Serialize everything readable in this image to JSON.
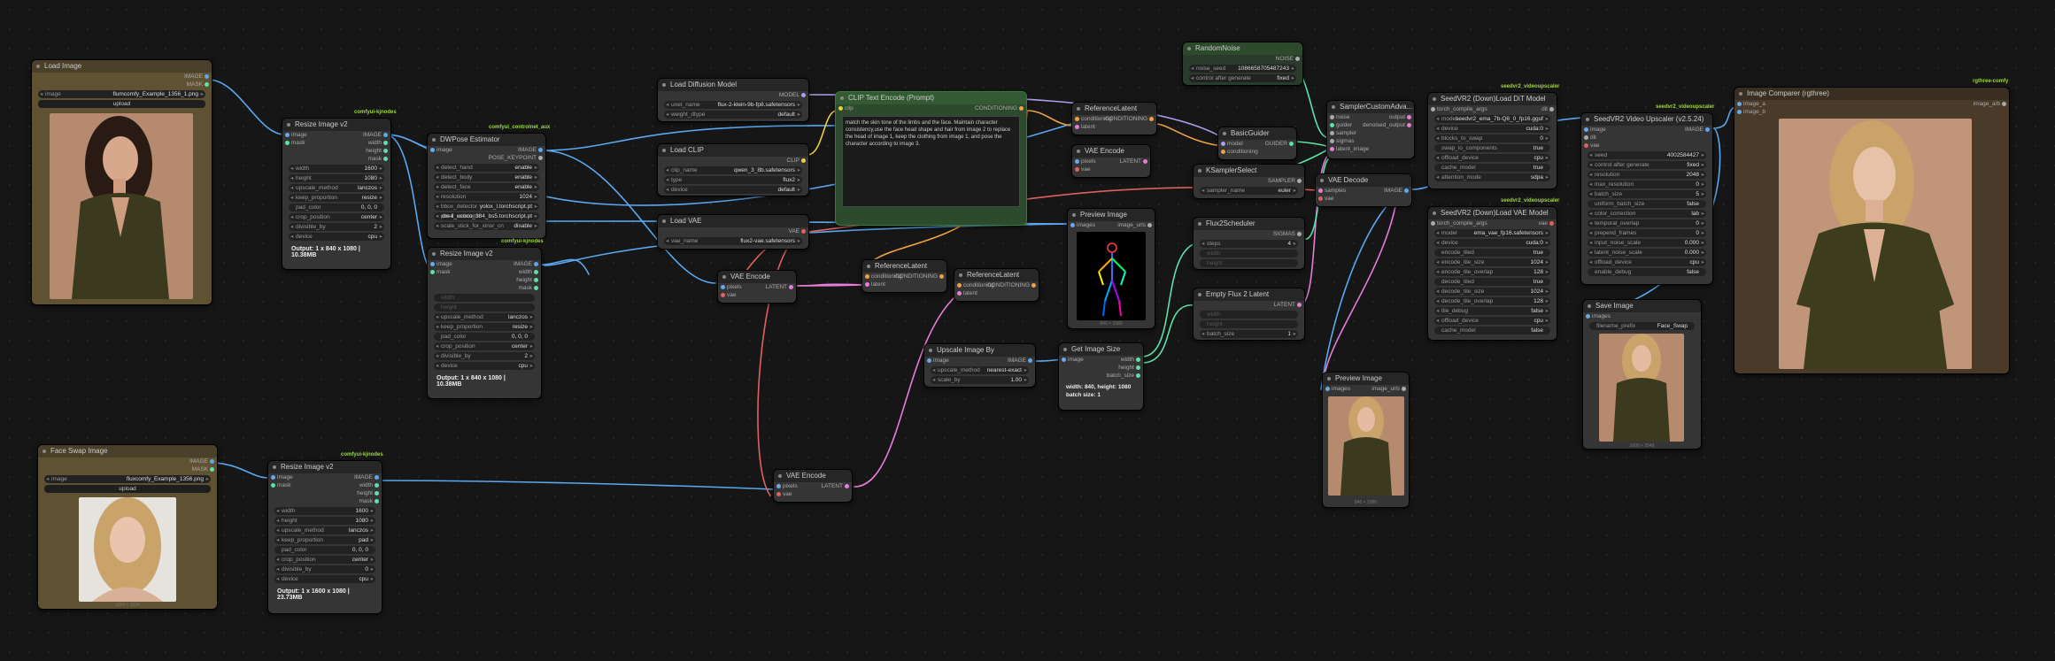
{
  "tags": {
    "comfyui_kjnodes": "comfyui-kjnodes",
    "controlnet_aux": "comfyui_controlnet_aux",
    "videoupscaler": "seedvr2_videoupscaler",
    "rgthree": "rgthree-comfy"
  },
  "load_image": {
    "title": "Load Image",
    "out_image": "IMAGE",
    "out_mask": "MASK",
    "image_label": "image",
    "image_value": "flumcomfy_Example_1356_1.png",
    "upload": "upload"
  },
  "face_swap": {
    "title": "Face Swap Image",
    "out_image": "IMAGE",
    "out_mask": "MASK",
    "image_label": "image",
    "image_value": "fluxcomfy_Example_1356.png",
    "upload": "upload",
    "caption": "1024 × 1024"
  },
  "resize1": {
    "title": "Resize Image v2",
    "in_image": "image",
    "in_mask": "mask",
    "out_image": "IMAGE",
    "out_width": "width",
    "out_height": "height",
    "out_mask": "mask",
    "widgets": [
      {
        "k": "width",
        "v": "1600"
      },
      {
        "k": "height",
        "v": "1080"
      },
      {
        "k": "upscale_method",
        "v": "lanczos"
      },
      {
        "k": "keep_proportion",
        "v": "resize"
      },
      {
        "k": "pad_color",
        "v": "0, 0, 0"
      },
      {
        "k": "crop_position",
        "v": "center"
      },
      {
        "k": "divisible_by",
        "v": "2"
      },
      {
        "k": "device",
        "v": "cpu"
      }
    ],
    "output": "Output: 1 x 840 x 1080 | 10.38MB"
  },
  "resize2": {
    "title": "Resize Image v2",
    "in_image": "image",
    "in_mask": "mask",
    "out_image": "IMAGE",
    "out_width": "width",
    "out_height": "height",
    "out_mask": "mask",
    "widgets": [
      {
        "k": "width",
        "v": ""
      },
      {
        "k": "height",
        "v": ""
      },
      {
        "k": "upscale_method",
        "v": "lanczos"
      },
      {
        "k": "keep_proportion",
        "v": "resize"
      },
      {
        "k": "pad_color",
        "v": "0, 0, 0"
      },
      {
        "k": "crop_position",
        "v": "center"
      },
      {
        "k": "divisible_by",
        "v": "2"
      },
      {
        "k": "device",
        "v": "cpu"
      }
    ],
    "output": "Output: 1 x 840 x 1080 | 10.38MB"
  },
  "resize3": {
    "title": "Resize Image v2",
    "in_image": "image",
    "in_mask": "mask",
    "out_image": "IMAGE",
    "out_width": "width",
    "out_height": "height",
    "out_mask": "mask",
    "widgets": [
      {
        "k": "width",
        "v": "1600"
      },
      {
        "k": "height",
        "v": "1080"
      },
      {
        "k": "upscale_method",
        "v": "lanczos"
      },
      {
        "k": "keep_proportion",
        "v": "pad"
      },
      {
        "k": "pad_color",
        "v": "0, 0, 0"
      },
      {
        "k": "crop_position",
        "v": "center"
      },
      {
        "k": "divisible_by",
        "v": "0"
      },
      {
        "k": "device",
        "v": "cpu"
      }
    ],
    "output": "Output: 1 x 1600 x 1080 | 23.73MB"
  },
  "dwpose": {
    "title": "DWPose Estimator",
    "in_image": "image",
    "out_image": "IMAGE",
    "out_kp": "POSE_KEYPOINT",
    "widgets": [
      {
        "k": "detect_hand",
        "v": "enable"
      },
      {
        "k": "detect_body",
        "v": "enable"
      },
      {
        "k": "detect_face",
        "v": "enable"
      },
      {
        "k": "resolution",
        "v": "1024"
      },
      {
        "k": "bbox_detector",
        "v": "yolox_l.torchscript.pt"
      },
      {
        "k": "pose_estimator",
        "v": "dw-ll_ucoco_384_bs5.torchscript.pt"
      },
      {
        "k": "scale_stick_for_xinsr_cn",
        "v": "disable"
      }
    ]
  },
  "load_diffusion": {
    "title": "Load Diffusion Model",
    "out": "MODEL",
    "widgets": [
      {
        "k": "unet_name",
        "v": "flux-2-klein-9b-fp8.safetensors"
      },
      {
        "k": "weight_dtype",
        "v": "default"
      }
    ]
  },
  "load_clip": {
    "title": "Load CLIP",
    "out": "CLIP",
    "widgets": [
      {
        "k": "clip_name",
        "v": "qwen_3_8b.safetensors"
      },
      {
        "k": "type",
        "v": "flux2"
      },
      {
        "k": "device",
        "v": "default"
      }
    ]
  },
  "load_vae": {
    "title": "Load VAE",
    "out": "VAE",
    "widgets": [
      {
        "k": "vae_name",
        "v": "flux2-vae.safetensors"
      }
    ]
  },
  "clip_text": {
    "title": "CLIP Text Encode (Prompt)",
    "in_clip": "clip",
    "out": "CONDITIONING",
    "text": "match the skin tone of the limbs and the face. Maintain character consistency,use the face head shape and hair from image 2 to replace the head of image 1, keep the clothing from image 1, and pose the character according to image 3."
  },
  "vae_encode1": {
    "title": "VAE Encode",
    "in_pixels": "pixels",
    "in_vae": "vae",
    "out": "LATENT"
  },
  "vae_encode2": {
    "title": "VAE Encode",
    "in_pixels": "pixels",
    "in_vae": "vae",
    "out": "LATENT"
  },
  "vae_encode3": {
    "title": "VAE Encode",
    "in_pixels": "pixels",
    "in_vae": "vae",
    "out": "LATENT"
  },
  "ref_latent1": {
    "title": "ReferenceLatent",
    "in_cond": "conditioning",
    "in_latent": "latent",
    "out": "CONDITIONING"
  },
  "ref_latent2": {
    "title": "ReferenceLatent",
    "in_cond": "conditioning",
    "in_latent": "latent",
    "out": "CONDITIONING"
  },
  "ref_latent3": {
    "title": "ReferenceLatent",
    "in_cond": "conditioning",
    "in_latent": "latent",
    "out": "CONDITIONING"
  },
  "preview1": {
    "title": "Preview Image",
    "in_images": "images",
    "out": "image_urls",
    "caption": "840 × 1080"
  },
  "preview2": {
    "title": "Preview Image",
    "in_images": "images",
    "out": "image_urls",
    "caption": "840 × 1080"
  },
  "upscale_by": {
    "title": "Upscale Image By",
    "in_image": "image",
    "out": "IMAGE",
    "widgets": [
      {
        "k": "upscale_method",
        "v": "nearest-exact"
      },
      {
        "k": "scale_by",
        "v": "1.00"
      }
    ]
  },
  "image_size": {
    "title": "Get Image Size",
    "in_image": "image",
    "out_w": "width",
    "out_h": "height",
    "out_b": "batch_size",
    "info1": "width: 840, height: 1080",
    "info2": "batch size: 1"
  },
  "random_noise": {
    "title": "RandomNoise",
    "out": "NOISE",
    "widgets": [
      {
        "k": "noise_seed",
        "v": "1086658705487243"
      },
      {
        "k": "control after generate",
        "v": "fixed"
      }
    ]
  },
  "basic_guider": {
    "title": "BasicGuider",
    "in_model": "model",
    "in_cond": "conditioning",
    "out": "GUIDER"
  },
  "ksampler_select": {
    "title": "KSamplerSelect",
    "out": "SAMPLER",
    "widgets": [
      {
        "k": "sampler_name",
        "v": "euler"
      }
    ]
  },
  "flux2_scheduler": {
    "title": "Flux2Scheduler",
    "out": "SIGMAS",
    "widgets": [
      {
        "k": "steps",
        "v": "4"
      },
      {
        "k": "width",
        "v": ""
      },
      {
        "k": "height",
        "v": ""
      }
    ]
  },
  "empty_latent": {
    "title": "Empty Flux 2 Latent",
    "out": "LATENT",
    "widgets": [
      {
        "k": "width",
        "v": ""
      },
      {
        "k": "height",
        "v": ""
      },
      {
        "k": "batch_size",
        "v": "1"
      }
    ]
  },
  "sampler_custom": {
    "title": "SamplerCustomAdva...",
    "inputs": [
      "noise",
      "guider",
      "sampler",
      "sigmas",
      "latent_image"
    ],
    "out1": "output",
    "out2": "denoised_output"
  },
  "vae_decode": {
    "title": "VAE Decode",
    "in_samples": "samples",
    "in_vae": "vae",
    "out": "IMAGE"
  },
  "seedvr_dit": {
    "title": "SeedVR2 (Down)Load DiT Model",
    "out": "dit",
    "in_args": "torch_compile_args",
    "widgets": [
      {
        "k": "model",
        "v": "seedvr2_ema_7b-Q8_0_fp16.gguf"
      },
      {
        "k": "device",
        "v": "cuda:0"
      },
      {
        "k": "blocks_to_swap",
        "v": "0"
      },
      {
        "k": "swap_io_components",
        "v": "true"
      },
      {
        "k": "offload_device",
        "v": "cpu"
      },
      {
        "k": "cache_model",
        "v": "true"
      },
      {
        "k": "attention_mode",
        "v": "sdpa"
      }
    ]
  },
  "seedvr_vae": {
    "title": "SeedVR2 (Down)Load VAE Model",
    "out": "vae",
    "in_args": "torch_compile_args",
    "widgets": [
      {
        "k": "model",
        "v": "ema_vae_fp16.safetensors"
      },
      {
        "k": "device",
        "v": "cuda:0"
      },
      {
        "k": "encode_tiled",
        "v": "true"
      },
      {
        "k": "encode_tile_size",
        "v": "1024"
      },
      {
        "k": "encode_tile_overlap",
        "v": "128"
      },
      {
        "k": "decode_tiled",
        "v": "true"
      },
      {
        "k": "decode_tile_size",
        "v": "1024"
      },
      {
        "k": "decode_tile_overlap",
        "v": "128"
      },
      {
        "k": "tile_debug",
        "v": "false"
      },
      {
        "k": "offload_device",
        "v": "cpu"
      },
      {
        "k": "cache_model",
        "v": "false"
      }
    ]
  },
  "seedvr_upscaler": {
    "title": "SeedVR2 Video Upscaler (v2.5.24)",
    "in_image": "image",
    "in_dit": "dit",
    "in_vae": "vae",
    "out": "IMAGE",
    "widgets": [
      {
        "k": "seed",
        "v": "4002584427"
      },
      {
        "k": "control after generate",
        "v": "fixed"
      },
      {
        "k": "resolution",
        "v": "2048"
      },
      {
        "k": "max_resolution",
        "v": "0"
      },
      {
        "k": "batch_size",
        "v": "5"
      },
      {
        "k": "uniform_batch_size",
        "v": "false"
      },
      {
        "k": "color_correction",
        "v": "lab"
      },
      {
        "k": "temporal_overlap",
        "v": "0"
      },
      {
        "k": "prepend_frames",
        "v": "0"
      },
      {
        "k": "input_noise_scale",
        "v": "0.000"
      },
      {
        "k": "latent_noise_scale",
        "v": "0.000"
      },
      {
        "k": "offload_device",
        "v": "cpu"
      },
      {
        "k": "enable_debug",
        "v": "false"
      }
    ]
  },
  "save_image": {
    "title": "Save Image",
    "in_images": "images",
    "widgets": [
      {
        "k": "filename_prefix",
        "v": "Face_Swap"
      }
    ],
    "caption": "1600 × 2048"
  },
  "comparer": {
    "title": "Image Comparer (rgthree)",
    "in_a": "image_a",
    "in_b": "image_b",
    "out": "image_a/b"
  },
  "colors": {
    "wire_image": "#5aa8f0",
    "wire_latent": "#e67dd8",
    "wire_vae": "#e06060",
    "wire_cond": "#f0a040",
    "wire_clip": "#e8d040",
    "wire_model": "#a8a0f0",
    "wire_misc": "#5ee0a8"
  }
}
